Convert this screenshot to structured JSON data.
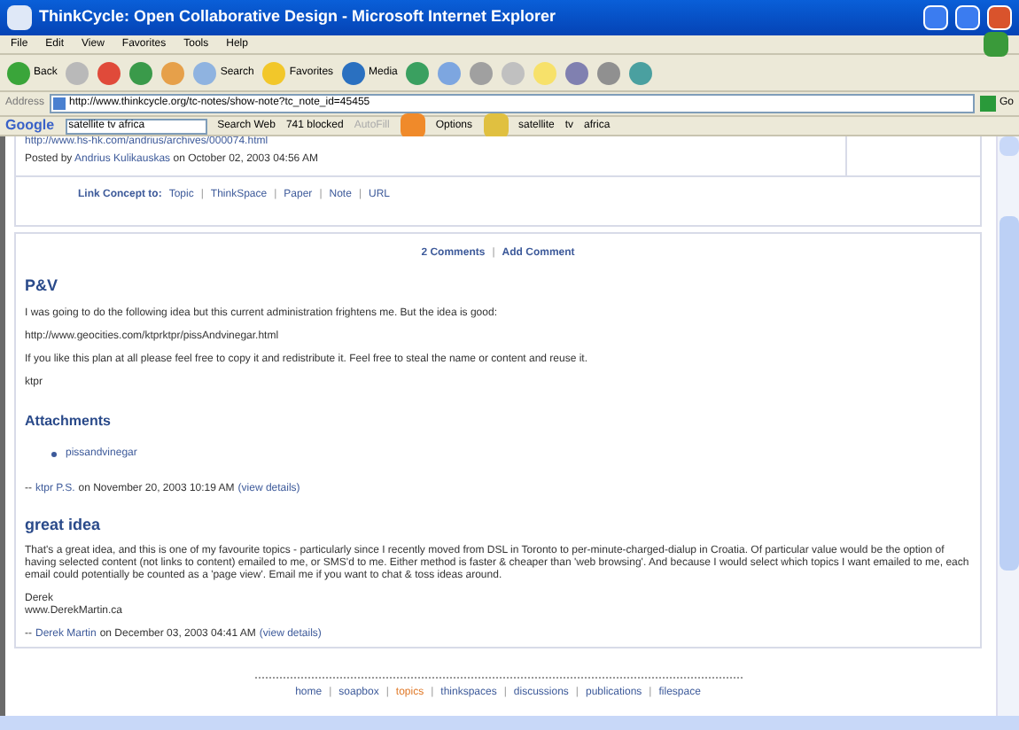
{
  "window": {
    "title": "ThinkCycle: Open Collaborative Design - Microsoft Internet Explorer"
  },
  "menu": [
    "File",
    "Edit",
    "View",
    "Favorites",
    "Tools",
    "Help"
  ],
  "toolbar": [
    {
      "kind": "back",
      "label": "Back"
    },
    {
      "kind": "forward"
    },
    {
      "kind": "stop"
    },
    {
      "kind": "refresh"
    },
    {
      "kind": "home"
    },
    {
      "kind": "search",
      "label": "Search"
    },
    {
      "kind": "favorites",
      "label": "Favorites"
    },
    {
      "kind": "media",
      "label": "Media"
    },
    {
      "kind": "history"
    },
    {
      "kind": "mail"
    },
    {
      "kind": "print"
    },
    {
      "kind": "edit"
    },
    {
      "kind": "folder"
    },
    {
      "kind": "research"
    },
    {
      "kind": "discuss"
    },
    {
      "kind": "messenger"
    }
  ],
  "address": {
    "label": "Address",
    "url": "http://www.thinkcycle.org/tc-notes/show-note?tc_note_id=45455",
    "go": "Go"
  },
  "google_bar": {
    "logo": "Google",
    "search": "satellite tv africa",
    "search_web": "Search Web",
    "blocked": "741 blocked",
    "autofill": "AutoFill",
    "autofill_disabled": true,
    "options": "Options",
    "terms": [
      "satellite",
      "tv",
      "africa"
    ]
  },
  "note": {
    "top_link": "http://www.hs-hk.com/andrius/archives/000074.html",
    "posted_prefix": "Posted by",
    "author": "Andrius Kulikauskas",
    "posted_suffix": "on October 02, 2003 04:56 AM",
    "link_label": "Link Concept to:",
    "links": [
      "Topic",
      "ThinkSpace",
      "Paper",
      "Note",
      "URL"
    ]
  },
  "separator": "|",
  "comments_bar": [
    "2 Comments",
    "Add Comment"
  ],
  "comments": [
    {
      "title": "P&V",
      "paragraphs": [
        "I was going to do the following idea but this current administration frightens me. But the idea is good:",
        "http://www.geocities.com/ktprktpr/pissAndvinegar.html",
        "If you like this plan at all please feel free to copy it and redistribute it. Feel free to steal the name or content and reuse it.",
        "ktpr"
      ],
      "attachments_title": "Attachments",
      "attachments": [
        "pissandvinegar"
      ],
      "byline": {
        "dash": "--",
        "author": "ktpr P.S.",
        "date": "on November 20, 2003 10:19 AM",
        "details": "(view details)"
      }
    },
    {
      "title": "great idea",
      "paragraphs": [
        "That's a great idea, and this is one of my favourite topics - particularly since I recently moved from DSL in Toronto to per-minute-charged-dialup in Croatia. Of particular value would be the option of having selected content (not links to content) emailed to me, or SMS'd to me. Either method is faster & cheaper than 'web browsing'. And because I would select which topics I want emailed to me, each email could potentially be counted as a 'page view'. Email me if you want to chat & toss ideas around."
      ],
      "signature": [
        "Derek",
        "www.DerekMartin.ca"
      ],
      "byline": {
        "dash": "--",
        "author": "Derek Martin",
        "date": "on December 03, 2003 04:41 AM",
        "details": "(view details)"
      }
    }
  ],
  "footer": [
    {
      "label": "home",
      "selected": false
    },
    {
      "label": "soapbox",
      "selected": false
    },
    {
      "label": "topics",
      "selected": true
    },
    {
      "label": "thinkspaces",
      "selected": false
    },
    {
      "label": "discussions",
      "selected": false
    },
    {
      "label": "publications",
      "selected": false
    },
    {
      "label": "filespace",
      "selected": false
    }
  ]
}
